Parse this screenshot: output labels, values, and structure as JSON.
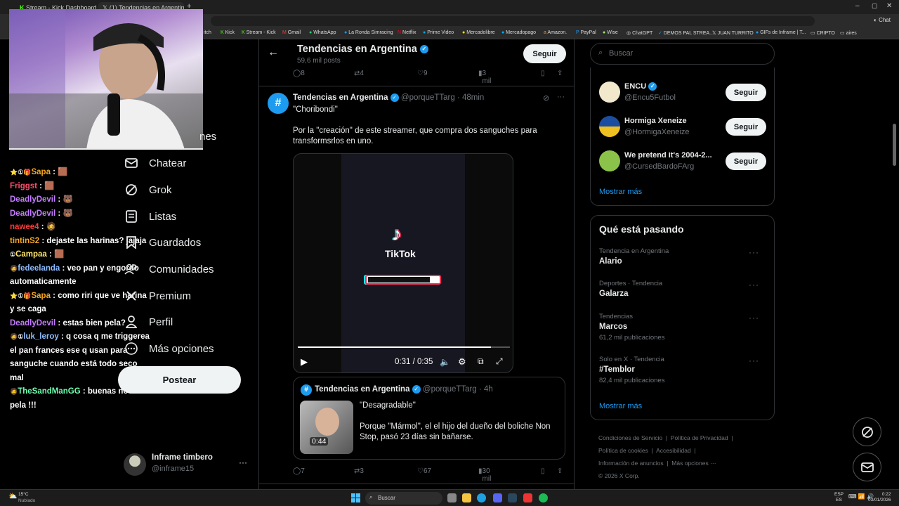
{
  "browser": {
    "tabs": [
      "Stream - Kick Dashboard",
      "(1) Tendencias en Argentina (@po..."
    ],
    "bookmarks": [
      "itch",
      "Kick",
      "Stream - Kick",
      "Gmail",
      "WhatsApp",
      "La Ronda Simracing",
      "Netflix",
      "Prime Video",
      "Mercadolibre",
      "Mercadopago",
      "Amazon.",
      "PayPal",
      "Wise",
      "ChatGPT",
      "DEMOS PAL STREA...",
      "JUAN TURRITO",
      "GIFs de Inframe | T...",
      "CRIPTO",
      "aires"
    ],
    "chat_label": "Chat"
  },
  "chat": [
    {
      "badges": "⭐①🎁",
      "user": "Sapa",
      "color": "#f5a623",
      "text": "🟫"
    },
    {
      "badges": "",
      "user": "Friggst",
      "color": "#ff4d6d",
      "text": "🟫"
    },
    {
      "badges": "",
      "user": "DeadlyDevil",
      "color": "#c47cff",
      "text": "🐻"
    },
    {
      "badges": "",
      "user": "DeadlyDevil",
      "color": "#c47cff",
      "text": "🐻"
    },
    {
      "badges": "",
      "user": "nawee4",
      "color": "#ff3b3b",
      "text": "🧔"
    },
    {
      "badges": "",
      "user": "tintinS2",
      "color": "#f5a623",
      "text": "dejaste las harinas? jajaja"
    },
    {
      "badges": "①",
      "user": "Campaa",
      "color": "#ffe66d",
      "text": "🟫"
    },
    {
      "badges": "🧔",
      "user": "fedeelanda",
      "color": "#8fbcff",
      "text": "veo pan y engordo automaticamente"
    },
    {
      "badges": "⭐①🎁",
      "user": "Sapa",
      "color": "#f5a623",
      "text": "como riri que ve harina y se caga"
    },
    {
      "badges": "",
      "user": "DeadlyDevil",
      "color": "#c47cff",
      "text": "estas bien pela?"
    },
    {
      "badges": "🧔①",
      "user": "luk_leroy",
      "color": "#8fbcff",
      "text": "q cosa q me triggerea el pan frances ese q usan para sanguche cuando está todo seco mal"
    },
    {
      "badges": "🧔",
      "user": "TheSandManGG",
      "color": "#6dffb0",
      "text": "buenas noches pela !!!"
    }
  ],
  "nav": {
    "partial_item": "nes",
    "items": [
      {
        "label": "Chatear",
        "icon": "mail-icon"
      },
      {
        "label": "Grok",
        "icon": "grok-icon"
      },
      {
        "label": "Listas",
        "icon": "list-icon"
      },
      {
        "label": "Guardados",
        "icon": "bookmark-icon"
      },
      {
        "label": "Comunidades",
        "icon": "communities-icon"
      },
      {
        "label": "Premium",
        "icon": "x-icon"
      },
      {
        "label": "Perfil",
        "icon": "person-icon"
      },
      {
        "label": "Más opciones",
        "icon": "more-icon"
      }
    ],
    "post_label": "Postear"
  },
  "account": {
    "name": "Inframe timbero",
    "handle": "@inframe15",
    "more": "···"
  },
  "header": {
    "title": "Tendencias en Argentina",
    "subtitle": "59,6 mil posts",
    "follow_label": "Seguir"
  },
  "prev_tweet_actions": {
    "replies": "8",
    "reposts": "4",
    "likes": "9",
    "views": "3 mil"
  },
  "tweet": {
    "name": "Tendencias en Argentina",
    "handle": "@porqueTTarg",
    "time": "· 48min",
    "quote": "\"Choribondi\"",
    "body": "Por la \"creación\" de este streamer, que compra dos sanguches para transformsrlos en uno.",
    "video": {
      "brand": "TikTok",
      "time": "0:31 / 0:35",
      "progress": 0.91
    },
    "actions": {
      "replies": "7",
      "reposts": "3",
      "likes": "67",
      "views": "30 mil"
    }
  },
  "quoted": {
    "name": "Tendencias en Argentina",
    "handle": "@porqueTTarg",
    "time": "· 4h",
    "title": "\"Desagradable\"",
    "body": "Porque \"Mármol\", el el hijo del dueño del boliche Non Stop, pasó 23 días sin bañarse.",
    "duration": "0:44"
  },
  "search": {
    "placeholder": "Buscar"
  },
  "who_to_follow": {
    "accounts": [
      {
        "name": "ENCU",
        "handle": "@Encu5Futbol",
        "follow": "Seguir"
      },
      {
        "name": "Hormiga Xeneize",
        "handle": "@HormigaXeneize",
        "follow": "Seguir"
      },
      {
        "name": "We pretend it's 2004-2...",
        "handle": "@CursedBardoFArg",
        "follow": "Seguir"
      }
    ],
    "show_more": "Mostrar más"
  },
  "trending": {
    "title": "Qué está pasando",
    "items": [
      {
        "context": "Tendencia en Argentina",
        "name": "Alario",
        "count": ""
      },
      {
        "context": "Deportes · Tendencia",
        "name": "Galarza",
        "count": ""
      },
      {
        "context": "Tendencias",
        "name": "Marcos",
        "count": "61,2 mil publicaciones"
      },
      {
        "context": "Solo en X · Tendencia",
        "name": "#Temblor",
        "count": "82,4 mil publicaciones"
      }
    ],
    "show_more": "Mostrar más"
  },
  "footer": {
    "links": [
      "Condiciones de Servicio",
      "Política de Privacidad",
      "Política de cookies",
      "Accesibilidad",
      "Información de anuncios",
      "Más opciones ···"
    ],
    "copyright": "© 2026 X Corp."
  },
  "taskbar": {
    "weather_temp": "15°C",
    "weather_desc": "Nublado",
    "search": "Buscar",
    "lang1": "ESP",
    "lang2": "ES",
    "time": "0:22",
    "date": "03/01/2026"
  },
  "colors": {
    "accent": "#1d9bf0",
    "bg": "#000000",
    "border": "#2f3336",
    "muted": "#71767b"
  }
}
